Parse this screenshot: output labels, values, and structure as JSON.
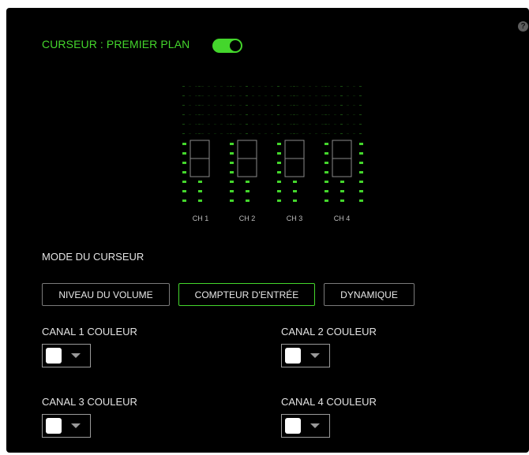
{
  "help_icon_glyph": "?",
  "header": {
    "title": "CURSEUR : PREMIER PLAN",
    "toggle_on": true
  },
  "meter": {
    "channels": [
      {
        "label": "CH 1",
        "slider_level": 0.5
      },
      {
        "label": "CH 2",
        "slider_level": 0.5
      },
      {
        "label": "CH 3",
        "slider_level": 0.5
      },
      {
        "label": "CH 4",
        "slider_level": 0.5
      }
    ]
  },
  "mode": {
    "label": "MODE DU CURSEUR",
    "options": [
      "NIVEAU DU VOLUME",
      "COMPTEUR D'ENTRÉE",
      "DYNAMIQUE"
    ],
    "selected": "COMPTEUR D'ENTRÉE"
  },
  "channel_colors": [
    {
      "label": "CANAL 1 COULEUR",
      "color": "#ffffff"
    },
    {
      "label": "CANAL 2 COULEUR",
      "color": "#ffffff"
    },
    {
      "label": "CANAL 3 COULEUR",
      "color": "#ffffff"
    },
    {
      "label": "CANAL 4 COULEUR",
      "color": "#ffffff"
    }
  ],
  "colors": {
    "accent": "#44d62c",
    "background": "#000000"
  }
}
